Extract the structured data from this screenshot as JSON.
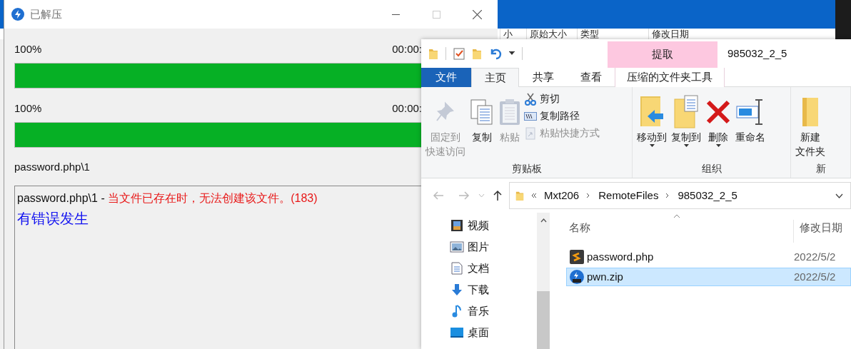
{
  "background_window": {
    "columns": [
      "小",
      "原始大小",
      "类型",
      "修改日期"
    ]
  },
  "dialog": {
    "title": "已解压",
    "progress": [
      {
        "percent": "100%",
        "time": "00:00:",
        "level": 1
      },
      {
        "percent": "100%",
        "time": "00:00:",
        "level": 1
      }
    ],
    "current_file": "password.php\\1",
    "log": [
      {
        "kind": "error",
        "file": "password.php\\1 - ",
        "message": "当文件已存在时，无法创建该文件。(183)"
      },
      {
        "kind": "notice",
        "text": "有错误发生"
      }
    ]
  },
  "explorer": {
    "context_tab": "提取",
    "title": "985032_2_5",
    "tabs": [
      {
        "label": "文件",
        "kind": "file",
        "selected": false
      },
      {
        "label": "主页",
        "kind": "tab",
        "selected": true
      },
      {
        "label": "共享",
        "kind": "tab",
        "selected": false
      },
      {
        "label": "查看",
        "kind": "tab",
        "selected": false
      },
      {
        "label": "压缩的文件夹工具",
        "kind": "context",
        "selected": false
      }
    ],
    "ribbon_groups": [
      {
        "label": "剪贴板",
        "items": [
          {
            "kind": "large",
            "lines": [
              "固定到",
              "快速访问"
            ],
            "disabled": true,
            "dropdown": false
          },
          {
            "kind": "large",
            "lines": [
              "复制"
            ],
            "disabled": false,
            "dropdown": false
          },
          {
            "kind": "large",
            "lines": [
              "粘贴"
            ],
            "disabled": true,
            "dropdown": false
          },
          {
            "kind": "small",
            "lines": [
              "剪切"
            ],
            "disabled": false
          },
          {
            "kind": "small",
            "lines": [
              "复制路径"
            ],
            "disabled": false
          },
          {
            "kind": "small",
            "lines": [
              "粘贴快捷方式"
            ],
            "disabled": true
          }
        ]
      },
      {
        "label": "组织",
        "items": [
          {
            "kind": "large",
            "lines": [
              "移动到"
            ],
            "disabled": false,
            "dropdown": true
          },
          {
            "kind": "large",
            "lines": [
              "复制到"
            ],
            "disabled": false,
            "dropdown": true
          },
          {
            "kind": "large",
            "lines": [
              "删除"
            ],
            "disabled": false,
            "dropdown": true
          },
          {
            "kind": "large",
            "lines": [
              "重命名"
            ],
            "disabled": false,
            "dropdown": false
          }
        ]
      },
      {
        "label": "新",
        "items": [
          {
            "kind": "large",
            "lines": [
              "新建",
              "文件夹"
            ],
            "disabled": false,
            "dropdown": false
          }
        ]
      }
    ],
    "address": [
      "Mxt206",
      "RemoteFiles",
      "985032_2_5"
    ],
    "nav": [
      {
        "label": "视频"
      },
      {
        "label": "图片"
      },
      {
        "label": "文档"
      },
      {
        "label": "下载"
      },
      {
        "label": "音乐"
      },
      {
        "label": "桌面"
      }
    ],
    "columns": [
      "名称",
      "修改日期"
    ],
    "files": [
      {
        "name": "password.php",
        "kind": "php",
        "date": "2022/5/2",
        "selected": false
      },
      {
        "name": "pwn.zip",
        "kind": "zip",
        "date": "2022/5/2",
        "selected": true
      }
    ]
  }
}
